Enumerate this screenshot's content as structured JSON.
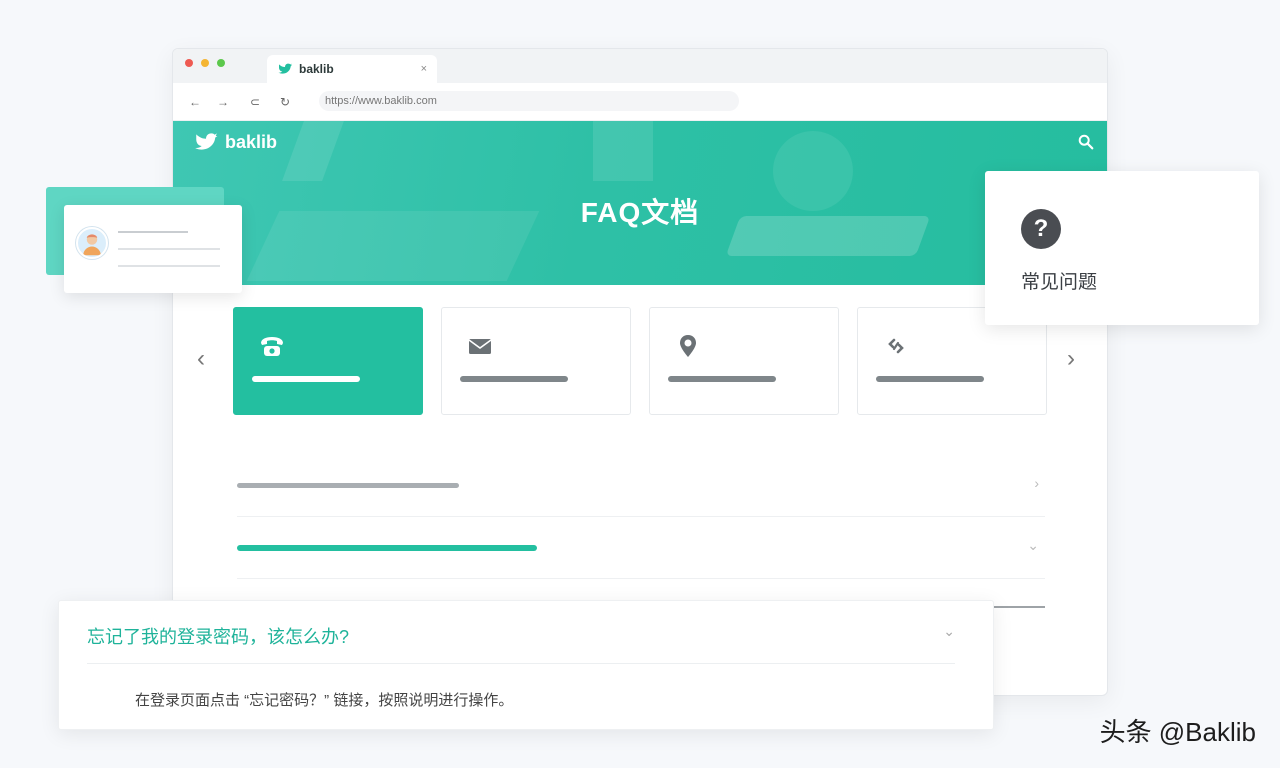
{
  "browser": {
    "tab_title": "baklib",
    "tab_close": "×",
    "url": "https://www.baklib.com",
    "nav": {
      "back": "←",
      "forward": "→",
      "reload": "⊂",
      "refresh": "↻"
    }
  },
  "hero": {
    "brand": "baklib",
    "title": "FAQ文档"
  },
  "carousel": {
    "prev": "‹",
    "next": "›",
    "cards": [
      {
        "icon": "phone-icon",
        "active": true
      },
      {
        "icon": "mail-icon",
        "active": false
      },
      {
        "icon": "location-pin-icon",
        "active": false
      },
      {
        "icon": "link-icon",
        "active": false
      }
    ]
  },
  "list": {
    "chevron_right": "›",
    "chevron_down": "⌄"
  },
  "faq_card": {
    "icon": "question-icon",
    "mark": "?",
    "label": "常见问题"
  },
  "qa_card": {
    "question": "忘记了我的登录密码，该怎么办?",
    "answer": "在登录页面点击 “忘记密码？” 链接，按照说明进行操作。",
    "chevron": "⌄"
  },
  "watermark": "头条 @Baklib",
  "colors": {
    "accent": "#23bfa0",
    "hero": "#2ec0a6"
  }
}
